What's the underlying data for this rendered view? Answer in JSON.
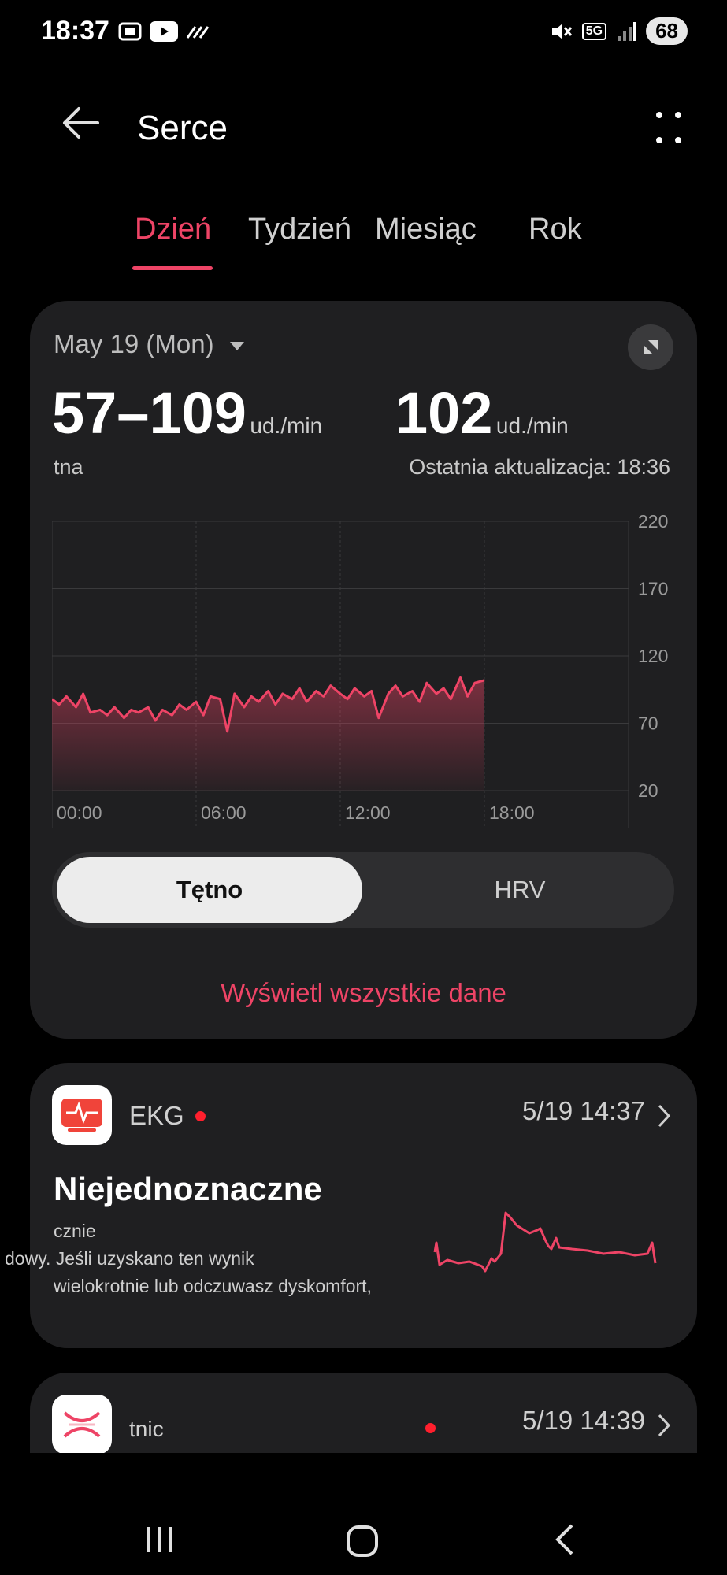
{
  "status_bar": {
    "time": "18:37",
    "battery": "68",
    "network": "5G"
  },
  "header": {
    "title": "Serce"
  },
  "tabs": [
    {
      "label": "Dzień",
      "active": true
    },
    {
      "label": "Tydzień",
      "active": false
    },
    {
      "label": "Miesiąc",
      "active": false
    },
    {
      "label": "Rok",
      "active": false
    }
  ],
  "summary": {
    "date": "May 19 (Mon)",
    "range_value": "57–109",
    "range_unit": "ud./min",
    "range_caption": "tna",
    "latest_value": "102",
    "latest_unit": "ud./min",
    "latest_caption": "Ostatnia aktualizacja: 18:36"
  },
  "chart_data": {
    "type": "area",
    "y_ticks": [
      "220",
      "170",
      "120",
      "70",
      "20"
    ],
    "x_ticks": [
      "00:00",
      "06:00",
      "12:00",
      "18:00"
    ],
    "ylim": [
      20,
      220
    ],
    "xlim": [
      0,
      24
    ],
    "grid": true,
    "color": "#ee4466",
    "x": [
      0,
      0.3,
      0.6,
      1,
      1.3,
      1.6,
      2,
      2.3,
      2.6,
      3,
      3.3,
      3.6,
      4,
      4.3,
      4.6,
      5,
      5.3,
      5.6,
      6,
      6.3,
      6.6,
      7,
      7.3,
      7.6,
      8,
      8.3,
      8.6,
      9,
      9.3,
      9.6,
      10,
      10.3,
      10.6,
      11,
      11.3,
      11.6,
      12,
      12.3,
      12.6,
      13,
      13.3,
      13.6,
      14,
      14.3,
      14.6,
      15,
      15.3,
      15.6,
      16,
      16.3,
      16.6,
      17,
      17.3,
      17.6,
      18
    ],
    "y": [
      88,
      84,
      90,
      82,
      92,
      78,
      80,
      76,
      82,
      74,
      80,
      78,
      82,
      72,
      80,
      76,
      84,
      80,
      86,
      76,
      90,
      88,
      64,
      92,
      82,
      90,
      86,
      94,
      84,
      92,
      88,
      96,
      86,
      94,
      90,
      98,
      92,
      88,
      96,
      90,
      94,
      74,
      92,
      98,
      90,
      94,
      86,
      100,
      92,
      96,
      88,
      104,
      90,
      100,
      102
    ]
  },
  "metric_toggle": {
    "active": "Tętno",
    "inactive": "HRV"
  },
  "view_all_label": "Wyświetl wszystkie dane",
  "ekg_card": {
    "name": "EKG",
    "timestamp": "5/19 14:37",
    "result": "Niejednoznaczne",
    "desc_line1": "cznie",
    "desc_line2": "dowy. Jeśli uzyskano ten wynik",
    "desc_line3": "wielokrotnie lub odczuwasz dyskomfort,"
  },
  "third_card": {
    "name": "tnic",
    "timestamp": "5/19 14:39"
  },
  "colors": {
    "accent": "#ee4466",
    "card_bg": "#1f1f21",
    "alert_dot": "#ff1f2d"
  }
}
